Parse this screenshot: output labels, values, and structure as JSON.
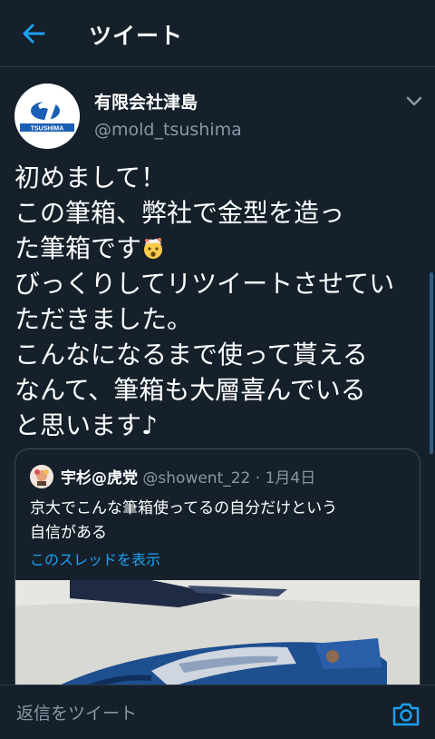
{
  "colors": {
    "background": "#15202b",
    "accent": "#1da1f2",
    "muted": "#8899a6",
    "border": "#2a3a4a"
  },
  "header": {
    "title": "ツイート",
    "back_icon": "arrow-left-icon"
  },
  "tweet": {
    "avatar_logo_text": "TSUSHIMA",
    "display_name": "有限会社津島",
    "handle": "@mold_tsushima",
    "more_icon": "chevron-down-icon",
    "text_part1": "初めまして！\nこの筆箱、弊社で金型を造っ\nた筆箱です",
    "emoji_icon": "exploding-head-icon",
    "text_part2": "\nびっくりしてリツイートさせてい\nただきました。\nこんなになるまで使って貰える\nなんて、筆箱も大層喜んでいる\nと思います♪"
  },
  "quote": {
    "name": "宇杉@虎党",
    "handle": "@showent_22",
    "separator": "·",
    "date": "1月4日",
    "text": "京大でこんな筆箱使ってるの自分だけという\n自信がある",
    "thread_link": "このスレッドを表示"
  },
  "reply": {
    "placeholder": "返信をツイート",
    "camera_icon": "camera-icon"
  }
}
